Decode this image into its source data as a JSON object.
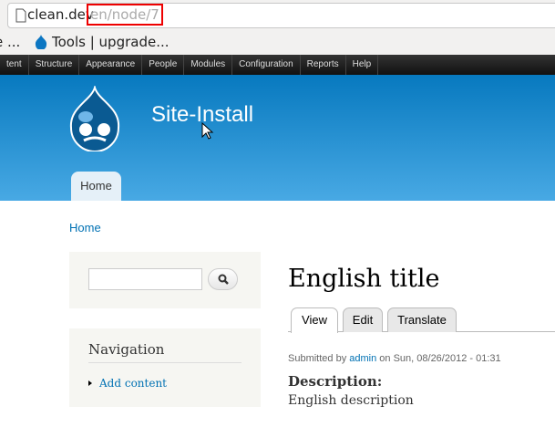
{
  "browser": {
    "url_host": "clean.dev",
    "url_path": "en/node/7",
    "bookmarks": [
      "e ...",
      "Tools | upgrade..."
    ]
  },
  "toolbar": [
    "tent",
    "Structure",
    "Appearance",
    "People",
    "Modules",
    "Configuration",
    "Reports",
    "Help"
  ],
  "header": {
    "site_name": "Site-Install",
    "home_tab": "Home"
  },
  "breadcrumb": "Home",
  "sidebar": {
    "search_value": "",
    "navigation_title": "Navigation",
    "links": [
      "Add content"
    ]
  },
  "node": {
    "title": "English title",
    "tabs": [
      "View",
      "Edit",
      "Translate"
    ],
    "submitted_prefix": "Submitted by",
    "author": "admin",
    "submitted_suffix": "on Sun, 08/26/2012 - 01:31",
    "field_label": "Description:",
    "field_value": "English description"
  }
}
